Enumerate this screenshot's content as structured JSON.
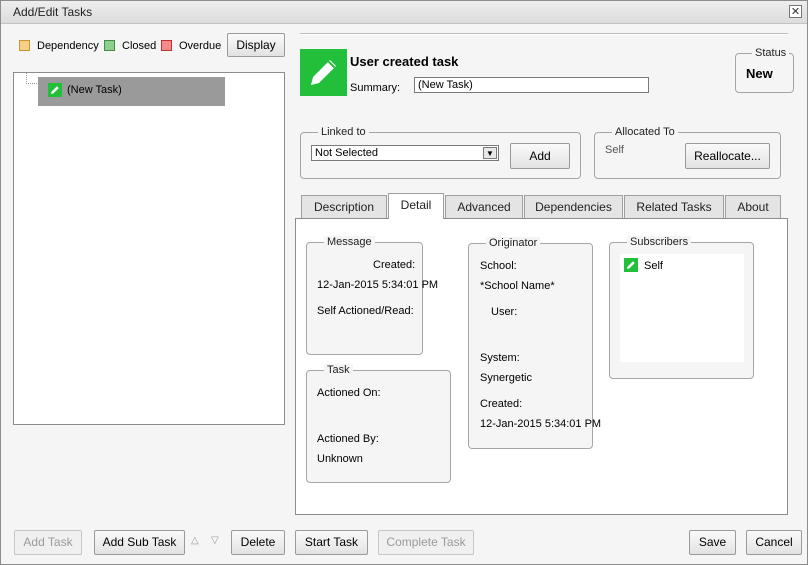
{
  "window": {
    "title": "Add/Edit Tasks"
  },
  "legend": {
    "items": [
      {
        "label": "Dependency",
        "fill": "#f7d088",
        "border": "#c9962e"
      },
      {
        "label": "Closed",
        "fill": "#8fcf8f",
        "border": "#3f8f3f"
      },
      {
        "label": "Overdue",
        "fill": "#f48a8a",
        "border": "#c03030"
      }
    ],
    "display_label": "Display"
  },
  "tree": {
    "selected_item": "(New Task)"
  },
  "task": {
    "heading": "User created task",
    "summary_label": "Summary:",
    "summary_value": "(New Task)"
  },
  "status": {
    "legend": "Status",
    "value": "New"
  },
  "linked_to": {
    "legend": "Linked to",
    "selected": "Not Selected",
    "add_label": "Add"
  },
  "allocated_to": {
    "legend": "Allocated To",
    "value": "Self",
    "reallocate_label": "Reallocate..."
  },
  "tabs": [
    "Description",
    "Detail",
    "Advanced",
    "Dependencies",
    "Related Tasks",
    "About"
  ],
  "detail": {
    "message": {
      "legend": "Message",
      "created_label": "Created:",
      "created_value": "12-Jan-2015 5:34:01 PM",
      "self_actioned_label": "Self Actioned/Read:"
    },
    "task": {
      "legend": "Task",
      "actioned_on_label": "Actioned On:",
      "actioned_by_label": "Actioned By:",
      "actioned_by_value": "Unknown"
    },
    "originator": {
      "legend": "Originator",
      "school_label": "School:",
      "school_value": "*School Name*",
      "user_label": "User:",
      "system_label": "System:",
      "system_value": "Synergetic",
      "created_label": "Created:",
      "created_value": "12-Jan-2015 5:34:01 PM"
    },
    "subscribers": {
      "legend": "Subscribers",
      "items": [
        "Self"
      ]
    }
  },
  "footer": {
    "add_task": "Add Task",
    "add_sub_task": "Add Sub Task",
    "delete": "Delete",
    "start_task": "Start Task",
    "complete_task": "Complete Task",
    "save": "Save",
    "cancel": "Cancel"
  },
  "icons": {
    "task": "pencil-icon",
    "close": "close-icon",
    "dropdown": "chevron-down-icon",
    "up": "triangle-up-icon",
    "down": "triangle-down-icon"
  }
}
